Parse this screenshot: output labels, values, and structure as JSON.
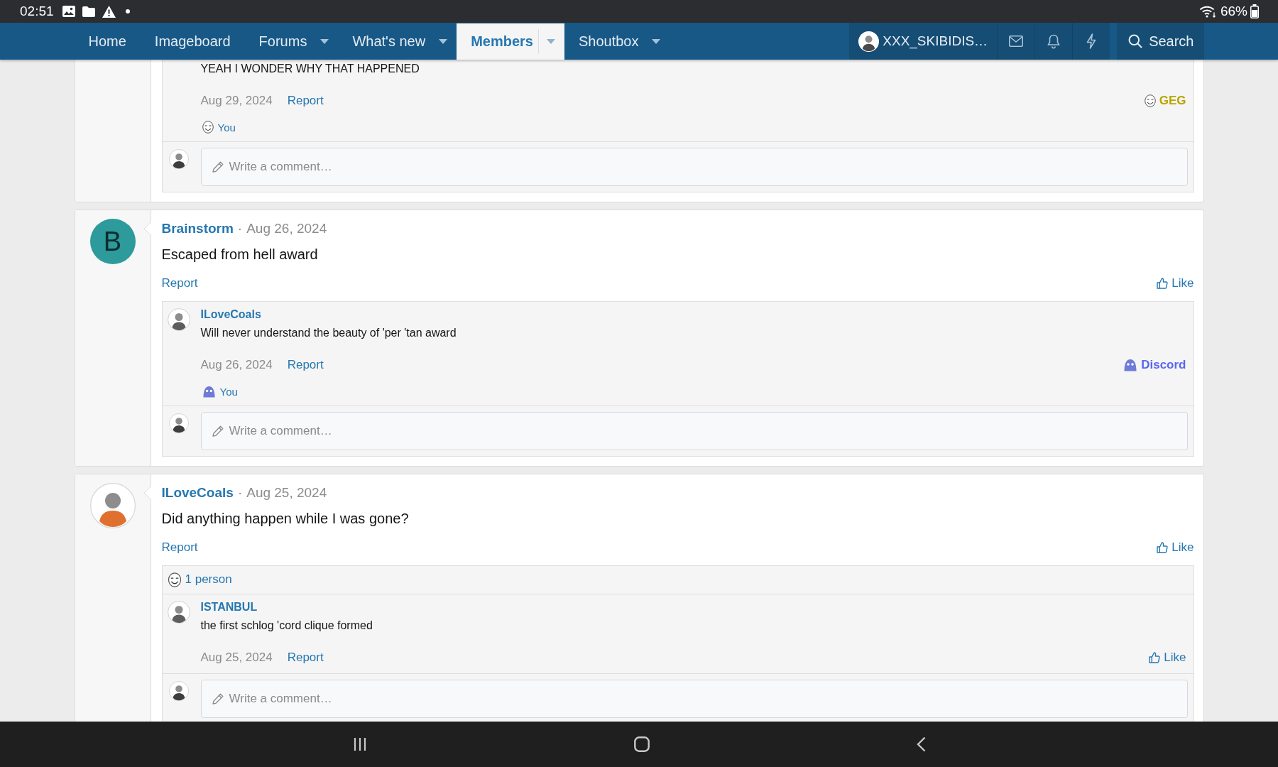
{
  "status_bar": {
    "time": "02:51",
    "battery": "66%"
  },
  "nav": {
    "tabs": [
      {
        "label": "Home",
        "selected": false,
        "has_menu": false
      },
      {
        "label": "Imageboard",
        "selected": false,
        "has_menu": false
      },
      {
        "label": "Forums",
        "selected": false,
        "has_menu": true
      },
      {
        "label": "What's new",
        "selected": false,
        "has_menu": true
      },
      {
        "label": "Members",
        "selected": true,
        "has_menu": true
      },
      {
        "label": "Shoutbox",
        "selected": false,
        "has_menu": true
      }
    ],
    "user": {
      "name": "XXX_SKIBIDIS…"
    },
    "search": {
      "label": "Search"
    }
  },
  "posts": [
    {
      "comments": [
        {
          "text": "YEAH I WONDER WHY THAT HAPPENED",
          "date": "Aug 29, 2024",
          "report": "Report",
          "reaction": {
            "kind": "face",
            "label": "GEG",
            "color": "#b9a400"
          },
          "reactions_summary": {
            "kind": "face",
            "text": "You"
          }
        }
      ],
      "comment_placeholder": "Write a comment…"
    },
    {
      "author": "Brainstorm",
      "separator": "·",
      "date": "Aug 26, 2024",
      "avatar": {
        "kind": "letter",
        "letter": "B",
        "color": "#2d9a9b"
      },
      "body": "Escaped from hell award",
      "report": "Report",
      "reaction": {
        "kind": "like",
        "label": "Like"
      },
      "comments": [
        {
          "author": "ILoveCoals",
          "text": "Will never understand the beauty of 'per 'tan award",
          "date": "Aug 26, 2024",
          "report": "Report",
          "reaction": {
            "kind": "mascot",
            "label": "Discord",
            "color": "#5865f2"
          },
          "reactions_summary": {
            "kind": "mascot",
            "text": "You"
          }
        }
      ],
      "comment_placeholder": "Write a comment…"
    },
    {
      "author": "ILoveCoals",
      "separator": "·",
      "date": "Aug 25, 2024",
      "avatar": {
        "kind": "picture"
      },
      "body": "Did anything happen while I was gone?",
      "report": "Report",
      "reaction": {
        "kind": "like",
        "label": "Like"
      },
      "reactions_summary": {
        "kind": "face",
        "text": "1 person"
      },
      "comments": [
        {
          "author": "ISTANBUL",
          "text": "the first schlog 'cord clique formed",
          "date": "Aug 25, 2024",
          "report": "Report",
          "reaction": {
            "kind": "like",
            "label": "Like"
          }
        }
      ],
      "comment_placeholder": "Write a comment…"
    }
  ]
}
